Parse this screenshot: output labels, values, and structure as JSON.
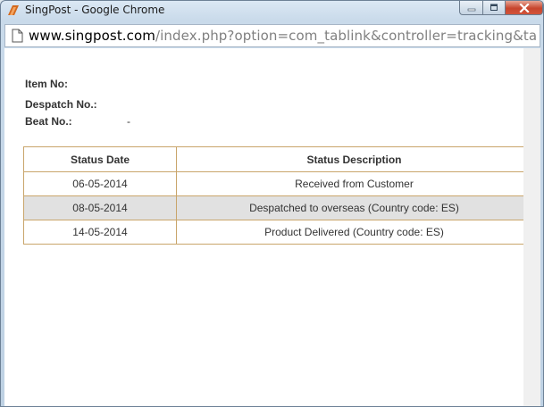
{
  "window": {
    "title": "SingPost - Google Chrome"
  },
  "address_bar": {
    "host": "www.singpost.com",
    "path": "/index.php?option=com_tablink&controller=tracking&task=tra"
  },
  "tracking": {
    "item_no_label": "Item No:",
    "item_no_value": "",
    "despatch_no_label": "Despatch No.:",
    "despatch_no_value": "",
    "beat_no_label": "Beat No.:",
    "beat_no_value": "-"
  },
  "status_table": {
    "headers": [
      "Status Date",
      "Status Description"
    ],
    "rows": [
      {
        "date": "06-05-2014",
        "description": "Received from Customer"
      },
      {
        "date": "08-05-2014",
        "description": "Despatched to overseas (Country code: ES)"
      },
      {
        "date": "14-05-2014",
        "description": "Product Delivered (Country code: ES)"
      }
    ]
  },
  "colors": {
    "table_border": "#c9a56b",
    "alt_row": "#e1e1e1",
    "close_button": "#c7452d"
  }
}
